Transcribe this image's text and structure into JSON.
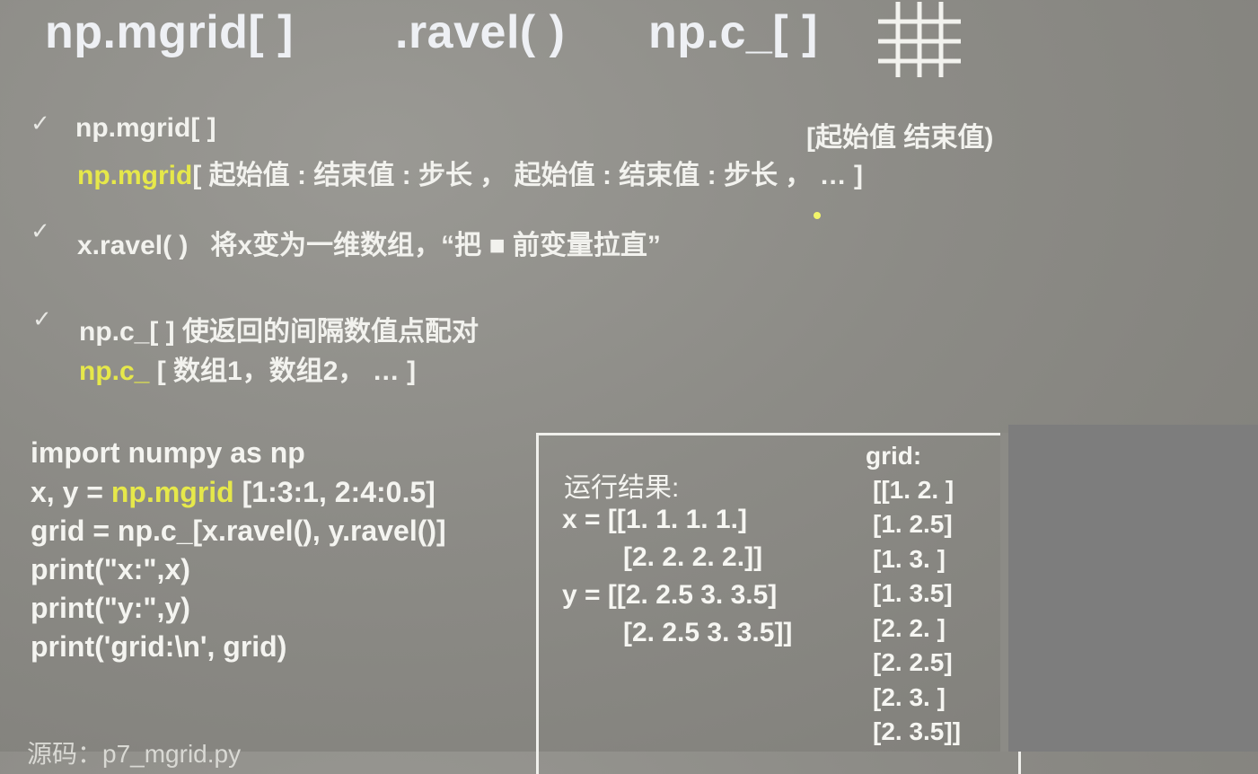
{
  "titles": [
    "np.mgrid[ ]",
    ".ravel( )",
    "np.c_[ ]"
  ],
  "icons": {
    "grid": "grid-icon",
    "check": "check-icon"
  },
  "bullets": {
    "mgrid": {
      "line1": "np.mgrid[ ]",
      "range_note": "[起始值  结束值)",
      "line2_code": "np.mgrid",
      "line2_rest": "[ 起始值 : 结束值 : 步长 ， 起始值 : 结束值 : 步长 ， … ]"
    },
    "ravel": {
      "code": "x.ravel( )",
      "desc": "将x变为一维数组，“把 ■ 前变量拉直”"
    },
    "c": {
      "code": "np.c_[ ]",
      "desc": "使返回的间隔数值点配对",
      "line2_code": "np.c_",
      "line2_rest": "[ 数组1，数组2， … ]"
    }
  },
  "code_lines": {
    "l1": "import numpy as np",
    "l2_a": "x, y = ",
    "l2_b": "np.mgrid",
    "l2_c": " [1:3:1, 2:4:0.5]",
    "l3": "grid = np.c_[x.ravel(), y.ravel()]",
    "l4": "print(\"x:\",x)",
    "l5": "print(\"y:\",y)",
    "l6": "print('grid:\\n', grid)"
  },
  "result": {
    "label": "运行结果:",
    "x1": "x = [[1. 1. 1. 1.]",
    "x2": "[2. 2. 2.  2.]]",
    "y1": "y = [[2. 2.5 3. 3.5]",
    "y2": "[2. 2.5 3. 3.5]]",
    "grid_label": "grid:",
    "grid_rows": [
      "[[1.  2. ]",
      "[1.  2.5]",
      "[1.  3. ]",
      "[1.  3.5]",
      "[2.  2. ]",
      "[2.  2.5]",
      "[2.  3. ]",
      "[2.  3.5]]"
    ]
  },
  "footer": "源码：p7_mgrid.py"
}
